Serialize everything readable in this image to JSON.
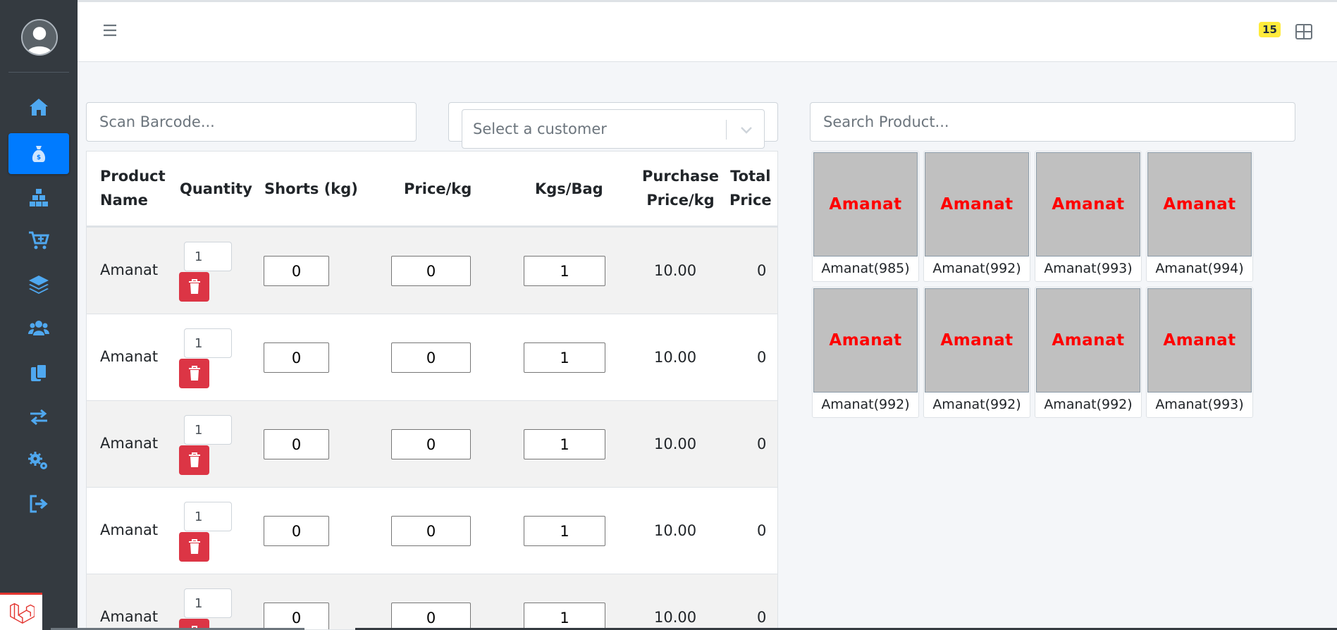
{
  "sidebar": {
    "items": [
      {
        "icon": "home-icon",
        "active": false
      },
      {
        "icon": "money-bag-icon",
        "active": true
      },
      {
        "icon": "boxes-icon",
        "active": false
      },
      {
        "icon": "cart-plus-icon",
        "active": false
      },
      {
        "icon": "layers-icon",
        "active": false
      },
      {
        "icon": "users-icon",
        "active": false
      },
      {
        "icon": "copy-icon",
        "active": false
      },
      {
        "icon": "exchange-icon",
        "active": false
      },
      {
        "icon": "cogs-icon",
        "active": false
      },
      {
        "icon": "sign-out-icon",
        "active": false
      }
    ],
    "icon_color": "#4fa8f0",
    "active_color": "#007bff"
  },
  "topbar": {
    "notification_count": "15"
  },
  "search": {
    "barcode_placeholder": "Scan Barcode...",
    "customer_placeholder": "Select a customer",
    "product_placeholder": "Search Product..."
  },
  "cart": {
    "headers": {
      "product_name": [
        "Product",
        "Name"
      ],
      "quantity": "Quantity",
      "shorts": "Shorts (kg)",
      "price_kg": "Price/kg",
      "kgs_bag": "Kgs/Bag",
      "purchase_price": [
        "Purchase",
        "Price/kg"
      ],
      "total_price": [
        "Total",
        "Price"
      ]
    },
    "rows": [
      {
        "name": "Amanat",
        "quantity": "1",
        "shorts": "0",
        "price_kg": "0",
        "kgs_bag": "1",
        "purchase_price": "10.00",
        "total": "0"
      },
      {
        "name": "Amanat",
        "quantity": "1",
        "shorts": "0",
        "price_kg": "0",
        "kgs_bag": "1",
        "purchase_price": "10.00",
        "total": "0"
      },
      {
        "name": "Amanat",
        "quantity": "1",
        "shorts": "0",
        "price_kg": "0",
        "kgs_bag": "1",
        "purchase_price": "10.00",
        "total": "0"
      },
      {
        "name": "Amanat",
        "quantity": "1",
        "shorts": "0",
        "price_kg": "0",
        "kgs_bag": "1",
        "purchase_price": "10.00",
        "total": "0"
      },
      {
        "name": "Amanat",
        "quantity": "1",
        "shorts": "0",
        "price_kg": "0",
        "kgs_bag": "1",
        "purchase_price": "10.00",
        "total": "0"
      }
    ]
  },
  "products": [
    {
      "image_text": "Amanat",
      "label": "Amanat(985)"
    },
    {
      "image_text": "Amanat",
      "label": "Amanat(992)"
    },
    {
      "image_text": "Amanat",
      "label": "Amanat(993)"
    },
    {
      "image_text": "Amanat",
      "label": "Amanat(994)"
    },
    {
      "image_text": "Amanat",
      "label": "Amanat(992)"
    },
    {
      "image_text": "Amanat",
      "label": "Amanat(992)"
    },
    {
      "image_text": "Amanat",
      "label": "Amanat(992)"
    },
    {
      "image_text": "Amanat",
      "label": "Amanat(993)"
    }
  ],
  "colors": {
    "sidebar_bg": "#343a40",
    "delete_button": "#dc3545",
    "product_image_bg": "#c0c0c0",
    "product_image_text": "#ff0000",
    "badge": "#ffeb3b"
  }
}
